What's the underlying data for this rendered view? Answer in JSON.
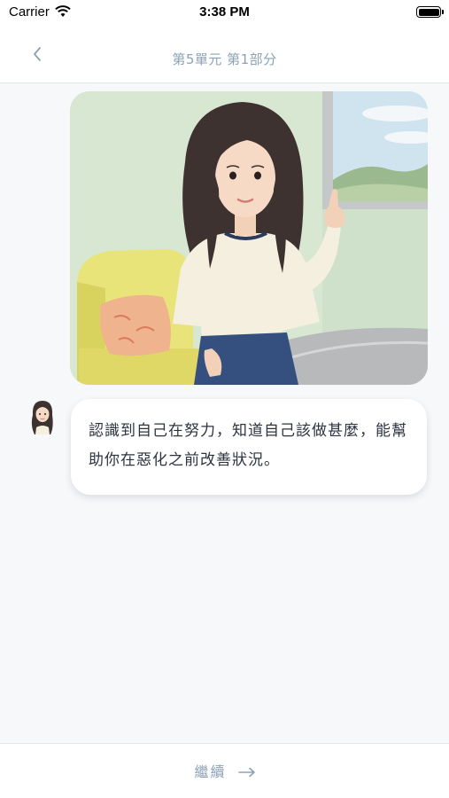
{
  "status_bar": {
    "carrier": "Carrier",
    "time": "3:38 PM",
    "icons": [
      "wifi-icon",
      "battery-icon"
    ]
  },
  "nav": {
    "back_icon": "chevron-left-icon",
    "title": "第5單元 第1部分"
  },
  "message": {
    "avatar": "character-avatar",
    "text": "認識到自己在努力，知道自己該做甚麼，能幫助你在惡化之前改善狀況。"
  },
  "footer": {
    "continue_label": "繼續",
    "continue_icon": "arrow-right-icon"
  },
  "colors": {
    "accent": "#8da2b5",
    "background": "#f6f8fa",
    "bubble": "#ffffff",
    "text": "#2d3440"
  }
}
